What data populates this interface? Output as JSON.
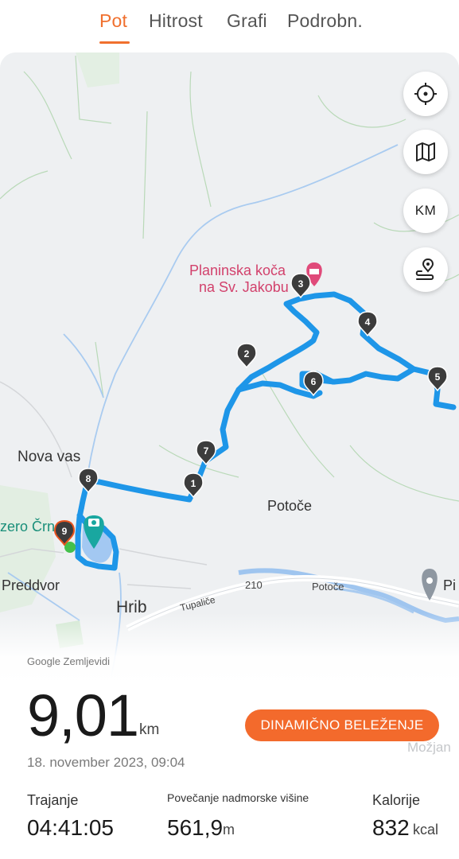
{
  "tabs": [
    {
      "label": "Pot",
      "active": true
    },
    {
      "label": "Hitrost",
      "active": false
    },
    {
      "label": "Grafi",
      "active": false
    },
    {
      "label": "Podrobn.",
      "active": false
    }
  ],
  "map": {
    "places": {
      "nova_vas": "Nova vas",
      "potoce": "Potoče",
      "preddvor": "Preddvor",
      "hrib": "Hrib",
      "jezero": "zero Črn",
      "pi": "Pi",
      "road_210": "210",
      "tupalice": "Tupaliče",
      "potoce_road": "Potoče",
      "mozjan": "Možjan"
    },
    "poi": {
      "line1": "Planinska koča",
      "line2": "na Sv. Jakobu"
    },
    "markers": [
      "1",
      "2",
      "3",
      "4",
      "5",
      "6",
      "7",
      "8",
      "9"
    ],
    "buttons": {
      "locate_icon": "crosshair-icon",
      "layers_icon": "map-icon",
      "units_label": "KM",
      "route_icon": "route-icon"
    },
    "route_color": "#1e96e8"
  },
  "stats": {
    "attribution": "Google Zemljevidi",
    "distance": "9,01",
    "distance_unit": "km",
    "dynamic_button": "DINAMIČNO BELEŽENJE",
    "datetime": "18. november 2023, 09:04",
    "duration_label": "Trajanje",
    "duration_value": "04:41:05",
    "elevation_label": "Povečanje nadmorske višine",
    "elevation_value": "561,9",
    "elevation_unit": "m",
    "calories_label": "Kalorije",
    "calories_value": "832",
    "calories_unit": "kcal"
  },
  "colors": {
    "accent": "#f0702e",
    "button": "#f36a2c"
  }
}
